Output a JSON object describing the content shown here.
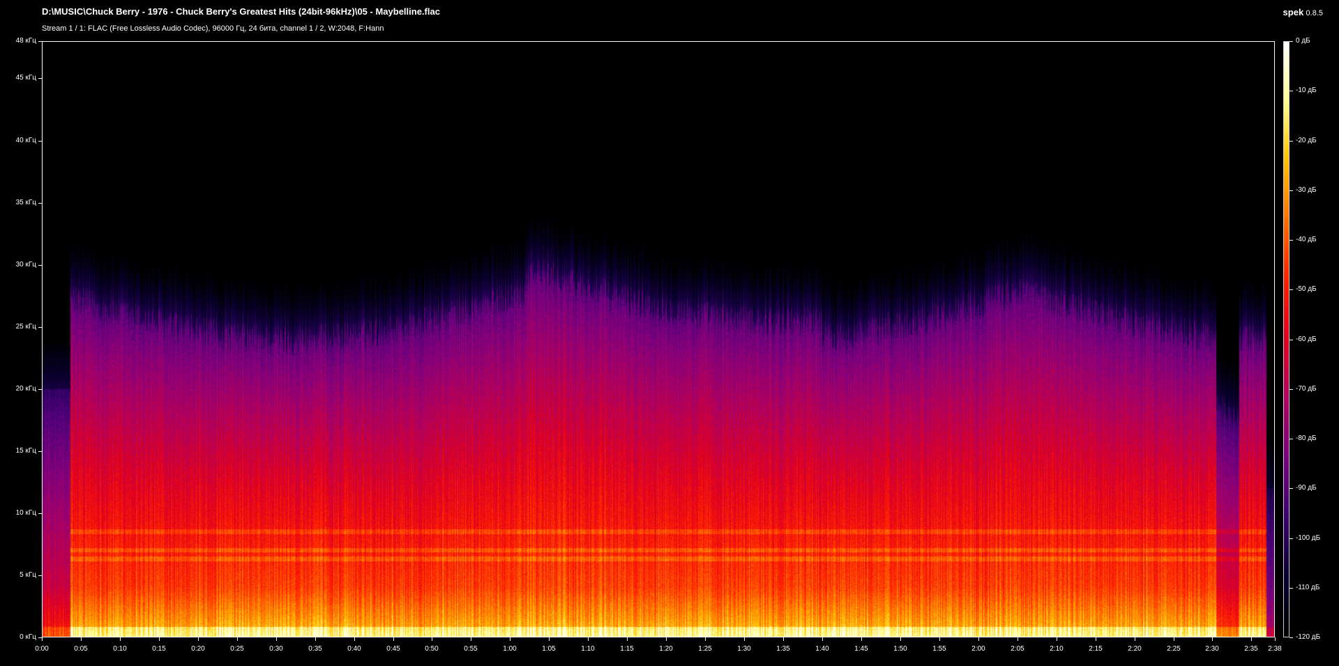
{
  "header": {
    "file_path": "D:\\MUSIC\\Chuck Berry - 1976 - Chuck Berry's Greatest Hits (24bit-96kHz)\\05 - Maybelline.flac",
    "stream_info": "Stream 1 / 1: FLAC (Free Lossless Audio Codec), 96000 Гц, 24 бита, channel 1 / 2, W:2048, F:Hann",
    "app_name": "spek",
    "app_version": "0.8.5"
  },
  "chart_data": {
    "type": "heatmap",
    "y_axis": {
      "range_khz": [
        0,
        48
      ],
      "ticks": [
        {
          "value": 48,
          "label": "48 кГц"
        },
        {
          "value": 45,
          "label": "45 кГц"
        },
        {
          "value": 40,
          "label": "40 кГц"
        },
        {
          "value": 35,
          "label": "35 кГц"
        },
        {
          "value": 30,
          "label": "30 кГц"
        },
        {
          "value": 25,
          "label": "25 кГц"
        },
        {
          "value": 20,
          "label": "20 кГц"
        },
        {
          "value": 15,
          "label": "15 кГц"
        },
        {
          "value": 10,
          "label": "10 кГц"
        },
        {
          "value": 5,
          "label": "5 кГц"
        },
        {
          "value": 0,
          "label": "0 кГц"
        }
      ]
    },
    "x_axis": {
      "range_seconds": [
        0,
        158
      ],
      "ticks": [
        {
          "value": 0,
          "label": "0:00"
        },
        {
          "value": 5,
          "label": "0:05"
        },
        {
          "value": 10,
          "label": "0:10"
        },
        {
          "value": 15,
          "label": "0:15"
        },
        {
          "value": 20,
          "label": "0:20"
        },
        {
          "value": 25,
          "label": "0:25"
        },
        {
          "value": 30,
          "label": "0:30"
        },
        {
          "value": 35,
          "label": "0:35"
        },
        {
          "value": 40,
          "label": "0:40"
        },
        {
          "value": 45,
          "label": "0:45"
        },
        {
          "value": 50,
          "label": "0:50"
        },
        {
          "value": 55,
          "label": "0:55"
        },
        {
          "value": 60,
          "label": "1:00"
        },
        {
          "value": 65,
          "label": "1:05"
        },
        {
          "value": 70,
          "label": "1:10"
        },
        {
          "value": 75,
          "label": "1:15"
        },
        {
          "value": 80,
          "label": "1:20"
        },
        {
          "value": 85,
          "label": "1:25"
        },
        {
          "value": 90,
          "label": "1:30"
        },
        {
          "value": 95,
          "label": "1:35"
        },
        {
          "value": 100,
          "label": "1:40"
        },
        {
          "value": 105,
          "label": "1:45"
        },
        {
          "value": 110,
          "label": "1:50"
        },
        {
          "value": 115,
          "label": "1:55"
        },
        {
          "value": 120,
          "label": "2:00"
        },
        {
          "value": 125,
          "label": "2:05"
        },
        {
          "value": 130,
          "label": "2:10"
        },
        {
          "value": 135,
          "label": "2:15"
        },
        {
          "value": 140,
          "label": "2:20"
        },
        {
          "value": 145,
          "label": "2:25"
        },
        {
          "value": 150,
          "label": "2:30"
        },
        {
          "value": 155,
          "label": "2:35"
        },
        {
          "value": 158,
          "label": "2:38"
        }
      ]
    },
    "colorbar": {
      "range_db": [
        -120,
        0
      ],
      "ticks": [
        {
          "value": 0,
          "label": "0 дБ"
        },
        {
          "value": -10,
          "label": "-10 дБ"
        },
        {
          "value": -20,
          "label": "-20 дБ"
        },
        {
          "value": -30,
          "label": "-30 дБ"
        },
        {
          "value": -40,
          "label": "-40 дБ"
        },
        {
          "value": -50,
          "label": "-50 дБ"
        },
        {
          "value": -60,
          "label": "-60 дБ"
        },
        {
          "value": -70,
          "label": "-70 дБ"
        },
        {
          "value": -80,
          "label": "-80 дБ"
        },
        {
          "value": -90,
          "label": "-90 дБ"
        },
        {
          "value": -100,
          "label": "-100 дБ"
        },
        {
          "value": -110,
          "label": "-110 дБ"
        },
        {
          "value": -120,
          "label": "-120 дБ"
        }
      ],
      "gradient": [
        "#000000",
        "#0a0030",
        "#3a0070",
        "#7a0080",
        "#b00060",
        "#e00020",
        "#ff2000",
        "#ff7000",
        "#ffc000",
        "#ffff90",
        "#ffffff"
      ]
    },
    "spectrum_profile": {
      "content_start_seconds": 3.5,
      "content_end_seconds": 157,
      "upper_cutoff_khz": 28,
      "dominant_band_khz": [
        0,
        4
      ],
      "harmonic_lines_khz": [
        8.5,
        7.0,
        6.3
      ]
    }
  }
}
